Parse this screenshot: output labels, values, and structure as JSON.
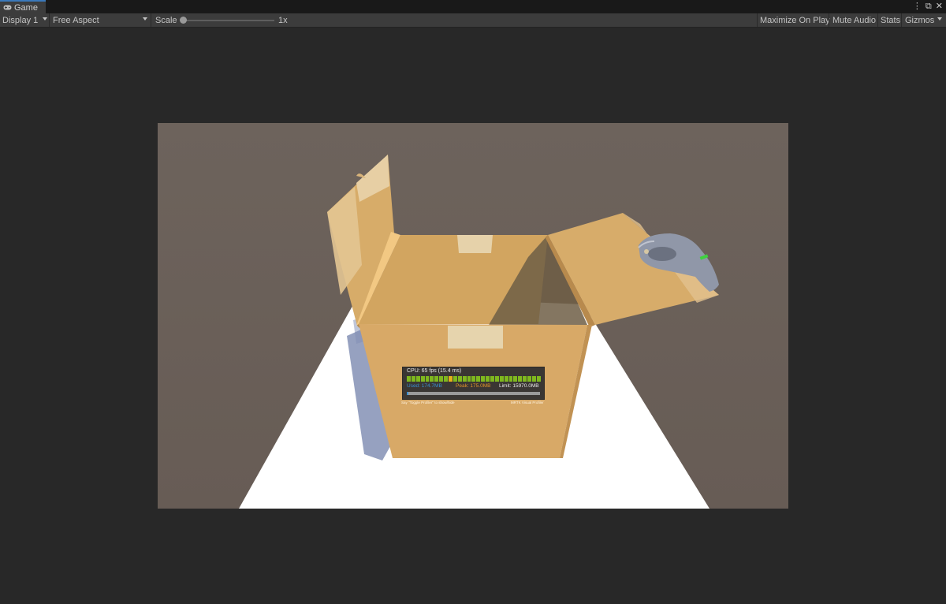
{
  "tab": {
    "title": "Game",
    "icon": "gamepad-icon"
  },
  "window_buttons": {
    "more": "⋮",
    "maximize": "⧉",
    "close": "✕"
  },
  "toolbar": {
    "display": "Display 1",
    "aspect": "Free Aspect",
    "scale_label": "Scale",
    "scale_value": "1x",
    "scale_fraction": 0.0,
    "maximize_on_play": "Maximize On Play",
    "mute_audio": "Mute Audio",
    "stats": "Stats",
    "gizmos": "Gizmos"
  },
  "profiler": {
    "cpu": "CPU: 65 fps (15.4 ms)",
    "used": "Used: 174.7MB",
    "peak": "Peak: 175.0MB",
    "limit": "Limit: 15970.0MB",
    "hint": "Say \"Toggle Profiler\" to show/hide",
    "brand": "MRTK Visual Profiler"
  },
  "colors": {
    "accent": "#3a79bb",
    "box": "#d9aa67",
    "floor": "#ffffff",
    "background": "#6b615a",
    "profiler_green": "#7fb81e",
    "profiler_used": "#3a8fd0",
    "profiler_peak": "#e3952a"
  }
}
